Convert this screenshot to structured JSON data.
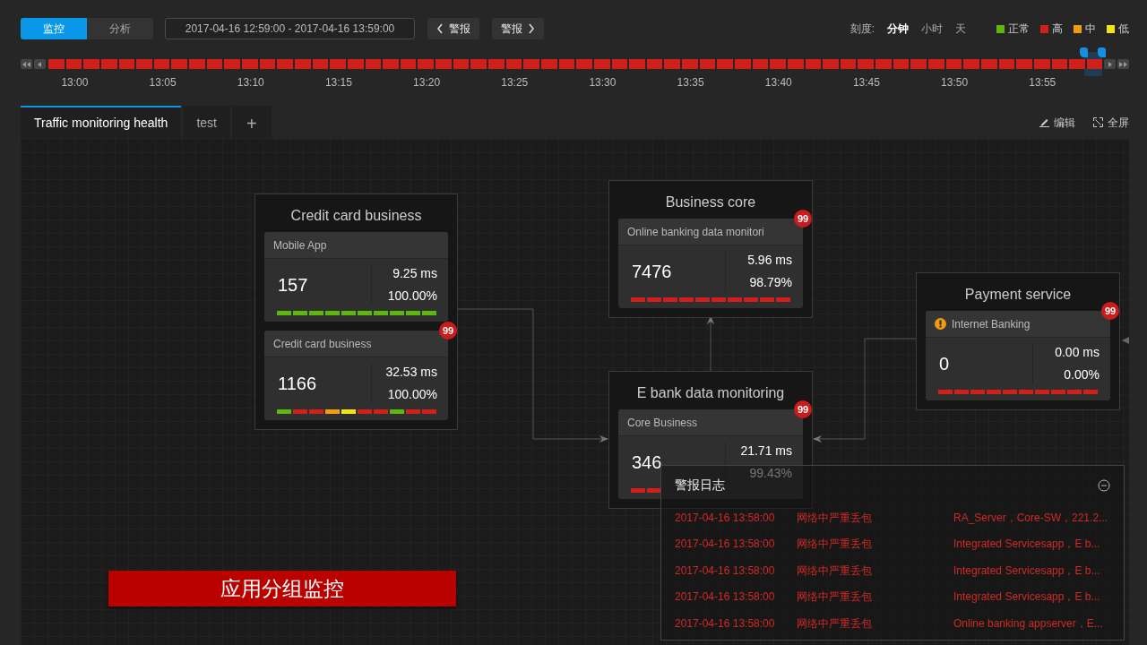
{
  "mode_tabs": [
    {
      "label": "监控",
      "selected": true
    },
    {
      "label": "分析",
      "selected": false
    }
  ],
  "time_range": "2017-04-16 12:59:00 - 2017-04-16 13:59:00",
  "alert_nav": [
    {
      "label": "警报",
      "kind": "prev"
    },
    {
      "label": "警报",
      "kind": "next"
    }
  ],
  "scale": {
    "label": "刻度:",
    "options": [
      {
        "label": "分钟",
        "selected": true
      },
      {
        "label": "小时",
        "selected": false
      },
      {
        "label": "天",
        "selected": false
      }
    ]
  },
  "legend": [
    {
      "label": "正常",
      "color": "#5cb80c"
    },
    {
      "label": "高",
      "color": "#d21f1a"
    },
    {
      "label": "中",
      "color": "#f39a0f"
    },
    {
      "label": "低",
      "color": "#f2e40f"
    }
  ],
  "timeline": {
    "segments": [
      {
        "color": "#d21f1a",
        "selected": false
      },
      {
        "color": "#d21f1a",
        "selected": false
      },
      {
        "color": "#d21f1a",
        "selected": false
      },
      {
        "color": "#d21f1a",
        "selected": false
      },
      {
        "color": "#d21f1a",
        "selected": false
      },
      {
        "color": "#d21f1a",
        "selected": false
      },
      {
        "color": "#d21f1a",
        "selected": false
      },
      {
        "color": "#d21f1a",
        "selected": false
      },
      {
        "color": "#d21f1a",
        "selected": false
      },
      {
        "color": "#d21f1a",
        "selected": false
      },
      {
        "color": "#d21f1a",
        "selected": false
      },
      {
        "color": "#d21f1a",
        "selected": false
      },
      {
        "color": "#d21f1a",
        "selected": false
      },
      {
        "color": "#d21f1a",
        "selected": false
      },
      {
        "color": "#d21f1a",
        "selected": false
      },
      {
        "color": "#d21f1a",
        "selected": false
      },
      {
        "color": "#d21f1a",
        "selected": false
      },
      {
        "color": "#d21f1a",
        "selected": false
      },
      {
        "color": "#d21f1a",
        "selected": false
      },
      {
        "color": "#d21f1a",
        "selected": false
      },
      {
        "color": "#d21f1a",
        "selected": false
      },
      {
        "color": "#d21f1a",
        "selected": false
      },
      {
        "color": "#d21f1a",
        "selected": false
      },
      {
        "color": "#d21f1a",
        "selected": false
      },
      {
        "color": "#d21f1a",
        "selected": false
      },
      {
        "color": "#d21f1a",
        "selected": false
      },
      {
        "color": "#d21f1a",
        "selected": false
      },
      {
        "color": "#d21f1a",
        "selected": false
      },
      {
        "color": "#d21f1a",
        "selected": false
      },
      {
        "color": "#d21f1a",
        "selected": false
      },
      {
        "color": "#d21f1a",
        "selected": false
      },
      {
        "color": "#d21f1a",
        "selected": false
      },
      {
        "color": "#d21f1a",
        "selected": false
      },
      {
        "color": "#d21f1a",
        "selected": false
      },
      {
        "color": "#d21f1a",
        "selected": false
      },
      {
        "color": "#d21f1a",
        "selected": false
      },
      {
        "color": "#d21f1a",
        "selected": false
      },
      {
        "color": "#d21f1a",
        "selected": false
      },
      {
        "color": "#d21f1a",
        "selected": false
      },
      {
        "color": "#d21f1a",
        "selected": false
      },
      {
        "color": "#d21f1a",
        "selected": false
      },
      {
        "color": "#d21f1a",
        "selected": false
      },
      {
        "color": "#d21f1a",
        "selected": false
      },
      {
        "color": "#d21f1a",
        "selected": false
      },
      {
        "color": "#d21f1a",
        "selected": false
      },
      {
        "color": "#d21f1a",
        "selected": false
      },
      {
        "color": "#d21f1a",
        "selected": false
      },
      {
        "color": "#d21f1a",
        "selected": false
      },
      {
        "color": "#d21f1a",
        "selected": false
      },
      {
        "color": "#d21f1a",
        "selected": false
      },
      {
        "color": "#d21f1a",
        "selected": false
      },
      {
        "color": "#d21f1a",
        "selected": false
      },
      {
        "color": "#d21f1a",
        "selected": false
      },
      {
        "color": "#d21f1a",
        "selected": false
      },
      {
        "color": "#d21f1a",
        "selected": false
      },
      {
        "color": "#d21f1a",
        "selected": false
      },
      {
        "color": "#d21f1a",
        "selected": false
      },
      {
        "color": "#d21f1a",
        "selected": false
      },
      {
        "color": "#d21f1a",
        "selected": false
      },
      {
        "color": "#d21f1a",
        "selected": true
      }
    ],
    "ticks": [
      "13:00",
      "13:05",
      "13:10",
      "13:15",
      "13:20",
      "13:25",
      "13:30",
      "13:35",
      "13:40",
      "13:45",
      "13:50",
      "13:55"
    ]
  },
  "view_tabs": [
    {
      "label": "Traffic monitoring health",
      "selected": true
    },
    {
      "label": "test",
      "selected": false
    },
    {
      "label": "+",
      "selected": false
    }
  ],
  "toolbar": [
    {
      "label": "编辑",
      "kind": "edit"
    },
    {
      "label": "全屏",
      "kind": "fullscreen"
    }
  ],
  "groups": [
    {
      "title": "Credit card business",
      "cards": [
        {
          "name": "Mobile App",
          "warning": false,
          "count": "157",
          "latency": "9.25 ms",
          "success_rate": "100.00%",
          "bars": [
            {
              "color": "#5cb80c"
            },
            {
              "color": "#5cb80c"
            },
            {
              "color": "#5cb80c"
            },
            {
              "color": "#5cb80c"
            },
            {
              "color": "#5cb80c"
            },
            {
              "color": "#5cb80c"
            },
            {
              "color": "#5cb80c"
            },
            {
              "color": "#5cb80c"
            },
            {
              "color": "#5cb80c"
            },
            {
              "color": "#5cb80c"
            }
          ]
        },
        {
          "name": "Credit card business",
          "warning": false,
          "badge": "99",
          "count": "1166",
          "latency": "32.53 ms",
          "success_rate": "100.00%",
          "bars": [
            {
              "color": "#5cb80c"
            },
            {
              "color": "#d21f1a"
            },
            {
              "color": "#d21f1a"
            },
            {
              "color": "#f39a0f"
            },
            {
              "color": "#f2e40f"
            },
            {
              "color": "#d21f1a"
            },
            {
              "color": "#d21f1a"
            },
            {
              "color": "#5cb80c"
            },
            {
              "color": "#d21f1a"
            },
            {
              "color": "#d21f1a"
            }
          ]
        }
      ]
    },
    {
      "title": "Business core",
      "cards": [
        {
          "name": "Online banking data monitori",
          "warning": false,
          "badge": "99",
          "count": "7476",
          "latency": "5.96 ms",
          "success_rate": "98.79%",
          "bars": [
            {
              "color": "#d21f1a"
            },
            {
              "color": "#d21f1a"
            },
            {
              "color": "#d21f1a"
            },
            {
              "color": "#d21f1a"
            },
            {
              "color": "#d21f1a"
            },
            {
              "color": "#d21f1a"
            },
            {
              "color": "#d21f1a"
            },
            {
              "color": "#d21f1a"
            },
            {
              "color": "#d21f1a"
            },
            {
              "color": "#d21f1a"
            }
          ]
        }
      ]
    },
    {
      "title": "E bank data monitoring",
      "cards": [
        {
          "name": "Core Business",
          "warning": false,
          "badge": "99",
          "count": "346",
          "latency": "21.71 ms",
          "success_rate": "99.43%",
          "bars": [
            {
              "color": "#d21f1a"
            },
            {
              "color": "#d21f1a"
            }
          ]
        }
      ]
    },
    {
      "title": "Payment service",
      "cards": [
        {
          "name": "Internet Banking",
          "warning": true,
          "badge": "99",
          "count": "0",
          "latency": "0.00 ms",
          "success_rate": "0.00%",
          "bars": [
            {
              "color": "#d21f1a"
            },
            {
              "color": "#d21f1a"
            },
            {
              "color": "#d21f1a"
            },
            {
              "color": "#d21f1a"
            },
            {
              "color": "#d21f1a"
            },
            {
              "color": "#d21f1a"
            },
            {
              "color": "#d21f1a"
            },
            {
              "color": "#d21f1a"
            },
            {
              "color": "#d21f1a"
            },
            {
              "color": "#d21f1a"
            }
          ]
        }
      ]
    }
  ],
  "banner": "应用分组监控",
  "alert_log": {
    "title": "警报日志",
    "rows": [
      {
        "time": "2017-04-16 13:58:00",
        "event": "网络中严重丢包",
        "source": "RA_Server，Core-SW，221.2..."
      },
      {
        "time": "2017-04-16 13:58:00",
        "event": "网络中严重丢包",
        "source": "Integrated Servicesapp，E b..."
      },
      {
        "time": "2017-04-16 13:58:00",
        "event": "网络中严重丢包",
        "source": "Integrated Servicesapp，E b..."
      },
      {
        "time": "2017-04-16 13:58:00",
        "event": "网络中严重丢包",
        "source": "Integrated Servicesapp，E b..."
      },
      {
        "time": "2017-04-16 13:58:00",
        "event": "网络中严重丢包",
        "source": "Online banking appserver，E..."
      }
    ]
  }
}
